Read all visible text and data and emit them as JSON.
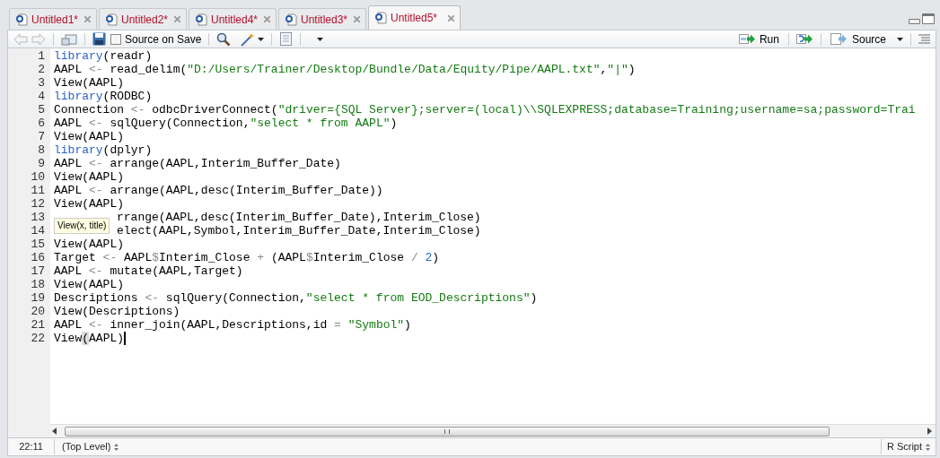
{
  "tabs": [
    {
      "label": "Untitled1*",
      "selected": false
    },
    {
      "label": "Untitled2*",
      "selected": false
    },
    {
      "label": "Untitled4*",
      "selected": false
    },
    {
      "label": "Untitled3*",
      "selected": false
    },
    {
      "label": "Untitled5*",
      "selected": true
    }
  ],
  "toolbar": {
    "source_on_save": {
      "label": "Source on Save",
      "checked": false
    },
    "run": "Run",
    "source": "Source"
  },
  "editor": {
    "lines": [
      {
        "number": "1",
        "tokens": [
          {
            "kind": "keyword",
            "text": "library"
          },
          {
            "kind": "plain",
            "text": "(readr)"
          }
        ]
      },
      {
        "number": "2",
        "tokens": [
          {
            "kind": "plain",
            "text": "AAPL "
          },
          {
            "kind": "operator",
            "text": "<-"
          },
          {
            "kind": "plain",
            "text": " read_delim("
          },
          {
            "kind": "string",
            "text": "\"D:/Users/Trainer/Desktop/Bundle/Data/Equity/Pipe/AAPL.txt\""
          },
          {
            "kind": "plain",
            "text": ","
          },
          {
            "kind": "string",
            "text": "\"|\""
          },
          {
            "kind": "plain",
            "text": ")"
          }
        ]
      },
      {
        "number": "3",
        "tokens": [
          {
            "kind": "plain",
            "text": "View(AAPL)"
          }
        ]
      },
      {
        "number": "4",
        "tokens": [
          {
            "kind": "keyword",
            "text": "library"
          },
          {
            "kind": "plain",
            "text": "(RODBC)"
          }
        ]
      },
      {
        "number": "5",
        "tokens": [
          {
            "kind": "plain",
            "text": "Connection "
          },
          {
            "kind": "operator",
            "text": "<-"
          },
          {
            "kind": "plain",
            "text": " odbcDriverConnect("
          },
          {
            "kind": "string",
            "text": "\"driver={SQL Server};server=(local)\\\\SQLEXPRESS;database=Training;username=sa;password=Trai"
          }
        ]
      },
      {
        "number": "6",
        "tokens": [
          {
            "kind": "plain",
            "text": "AAPL "
          },
          {
            "kind": "operator",
            "text": "<-"
          },
          {
            "kind": "plain",
            "text": " sqlQuery(Connection,"
          },
          {
            "kind": "string",
            "text": "\"select * from AAPL\""
          },
          {
            "kind": "plain",
            "text": ")"
          }
        ]
      },
      {
        "number": "7",
        "tokens": [
          {
            "kind": "plain",
            "text": "View(AAPL)"
          }
        ]
      },
      {
        "number": "8",
        "tokens": [
          {
            "kind": "keyword",
            "text": "library"
          },
          {
            "kind": "plain",
            "text": "(dplyr)"
          }
        ]
      },
      {
        "number": "9",
        "tokens": [
          {
            "kind": "plain",
            "text": "AAPL "
          },
          {
            "kind": "operator",
            "text": "<-"
          },
          {
            "kind": "plain",
            "text": " arrange(AAPL,Interim_Buffer_Date)"
          }
        ]
      },
      {
        "number": "10",
        "tokens": [
          {
            "kind": "plain",
            "text": "View(AAPL)"
          }
        ]
      },
      {
        "number": "11",
        "tokens": [
          {
            "kind": "plain",
            "text": "AAPL "
          },
          {
            "kind": "operator",
            "text": "<-"
          },
          {
            "kind": "plain",
            "text": " arrange(AAPL,desc(Interim_Buffer_Date))"
          }
        ]
      },
      {
        "number": "12",
        "tokens": [
          {
            "kind": "plain",
            "text": "View(AAPL)"
          }
        ]
      },
      {
        "number": "13",
        "under_tooltip": true,
        "tokens": [
          {
            "kind": "plain",
            "text": "rrange(AAPL,desc(Interim_Buffer_Date),Interim_Close)"
          }
        ]
      },
      {
        "number": "14",
        "under_tooltip": true,
        "tokens": [
          {
            "kind": "plain",
            "text": "elect(AAPL,Symbol,Interim_Buffer_Date,Interim_Close)"
          }
        ]
      },
      {
        "number": "15",
        "tokens": [
          {
            "kind": "plain",
            "text": "View(AAPL)"
          }
        ]
      },
      {
        "number": "16",
        "tokens": [
          {
            "kind": "plain",
            "text": "Target "
          },
          {
            "kind": "operator",
            "text": "<-"
          },
          {
            "kind": "plain",
            "text": " AAPL"
          },
          {
            "kind": "operator",
            "text": "$"
          },
          {
            "kind": "plain",
            "text": "Interim_Close "
          },
          {
            "kind": "operator",
            "text": "+"
          },
          {
            "kind": "plain",
            "text": " (AAPL"
          },
          {
            "kind": "operator",
            "text": "$"
          },
          {
            "kind": "plain",
            "text": "Interim_Close "
          },
          {
            "kind": "operator",
            "text": "/ "
          },
          {
            "kind": "number",
            "text": "2"
          },
          {
            "kind": "plain",
            "text": ")"
          }
        ]
      },
      {
        "number": "17",
        "tokens": [
          {
            "kind": "plain",
            "text": "AAPL "
          },
          {
            "kind": "operator",
            "text": "<-"
          },
          {
            "kind": "plain",
            "text": " mutate(AAPL,Target)"
          }
        ]
      },
      {
        "number": "18",
        "tokens": [
          {
            "kind": "plain",
            "text": "View(AAPL)"
          }
        ]
      },
      {
        "number": "19",
        "tokens": [
          {
            "kind": "plain",
            "text": "Descriptions "
          },
          {
            "kind": "operator",
            "text": "<-"
          },
          {
            "kind": "plain",
            "text": " sqlQuery(Connection,"
          },
          {
            "kind": "string",
            "text": "\"select * from EOD_Descriptions\""
          },
          {
            "kind": "plain",
            "text": ")"
          }
        ]
      },
      {
        "number": "20",
        "tokens": [
          {
            "kind": "plain",
            "text": "View(Descriptions)"
          }
        ]
      },
      {
        "number": "21",
        "tokens": [
          {
            "kind": "plain",
            "text": "AAPL "
          },
          {
            "kind": "operator",
            "text": "<-"
          },
          {
            "kind": "plain",
            "text": " inner_join(AAPL,Descriptions,id "
          },
          {
            "kind": "operator",
            "text": "= "
          },
          {
            "kind": "string",
            "text": "\"Symbol\""
          },
          {
            "kind": "plain",
            "text": ")"
          }
        ]
      },
      {
        "number": "22",
        "cursor": true,
        "tokens": [
          {
            "kind": "plain",
            "text": "View"
          },
          {
            "kind": "matched",
            "text": "("
          },
          {
            "kind": "plain",
            "text": "AAPL)"
          }
        ]
      }
    ],
    "tooltip": "View(x, title)"
  },
  "status_bar": {
    "position": "22:11",
    "scope": "(Top Level)",
    "file_type": "R Script"
  }
}
